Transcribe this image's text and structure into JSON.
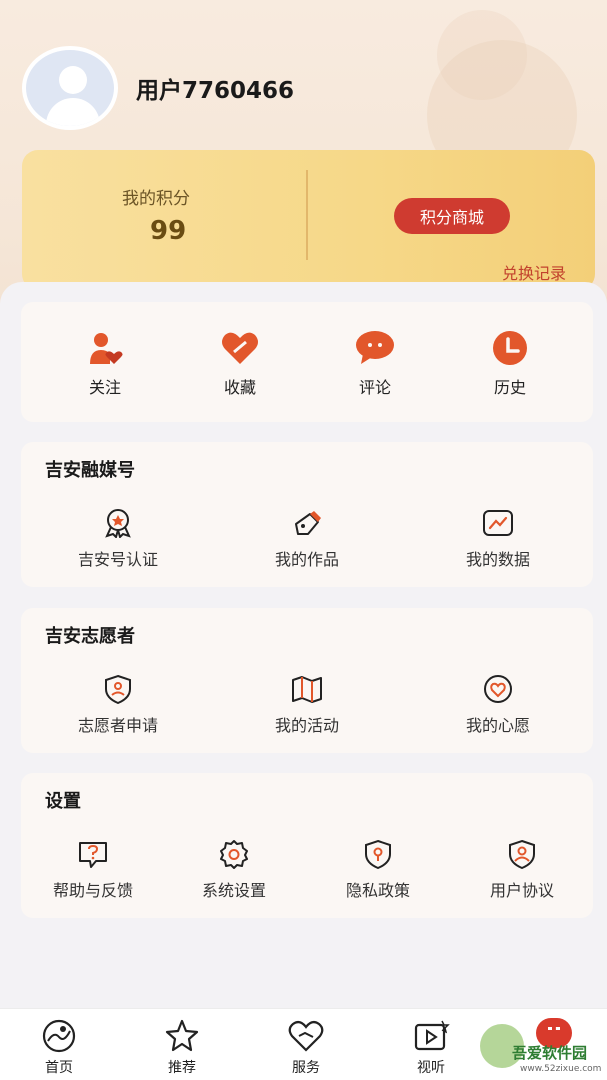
{
  "profile": {
    "username": "用户7760466"
  },
  "points": {
    "label": "我的积分",
    "value": "99",
    "mall_button": "积分商城",
    "exchange_link": "兑换记录"
  },
  "quick_actions": [
    {
      "label": "关注",
      "icon": "follow-icon"
    },
    {
      "label": "收藏",
      "icon": "favorite-heart-icon"
    },
    {
      "label": "评论",
      "icon": "comment-bubble-icon"
    },
    {
      "label": "历史",
      "icon": "history-clock-icon"
    }
  ],
  "sections": {
    "media": {
      "title": "吉安融媒号",
      "items": [
        {
          "label": "吉安号认证",
          "icon": "badge-award-icon"
        },
        {
          "label": "我的作品",
          "icon": "pen-edit-icon"
        },
        {
          "label": "我的数据",
          "icon": "chart-data-icon"
        }
      ]
    },
    "volunteer": {
      "title": "吉安志愿者",
      "items": [
        {
          "label": "志愿者申请",
          "icon": "volunteer-shield-icon"
        },
        {
          "label": "我的活动",
          "icon": "map-activity-icon"
        },
        {
          "label": "我的心愿",
          "icon": "heart-wish-icon"
        }
      ]
    },
    "settings": {
      "title": "设置",
      "items": [
        {
          "label": "帮助与反馈",
          "icon": "help-question-icon"
        },
        {
          "label": "系统设置",
          "icon": "gear-icon"
        },
        {
          "label": "隐私政策",
          "icon": "privacy-shield-icon"
        },
        {
          "label": "用户协议",
          "icon": "user-agreement-icon"
        }
      ]
    }
  },
  "tabbar": [
    {
      "label": "首页",
      "icon": "home-globe-icon"
    },
    {
      "label": "推荐",
      "icon": "star-recommend-icon"
    },
    {
      "label": "服务",
      "icon": "service-heart-icon"
    },
    {
      "label": "视听",
      "icon": "video-play-icon"
    }
  ],
  "watermark": {
    "text": "吾爱软件园",
    "sub": "www.52zixue.com"
  },
  "colors": {
    "accent": "#cf3b30",
    "icon_orange": "#e2572b",
    "card_gold": "#f6d888"
  }
}
